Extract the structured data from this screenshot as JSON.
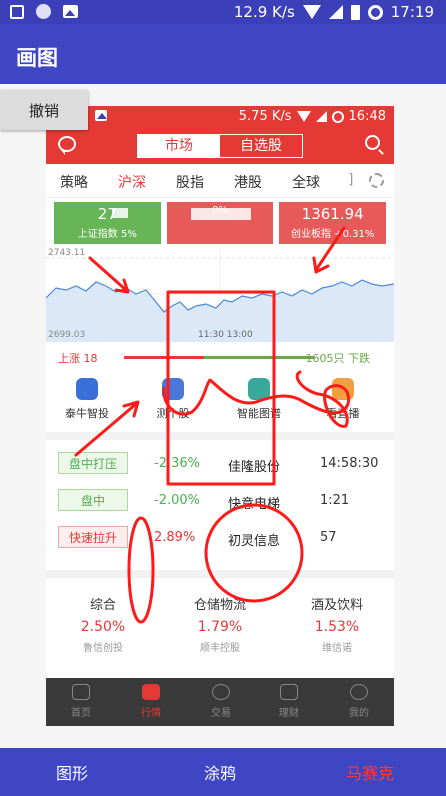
{
  "status_bar": {
    "speed": "12.9 K/s",
    "time": "17:19"
  },
  "app_bar": {
    "title": "画图"
  },
  "undo_button": {
    "label": "撤销"
  },
  "inner": {
    "status": {
      "speed": "5.75 K/s",
      "time": "16:48"
    },
    "segments": [
      "市场",
      "自选股"
    ],
    "tabs": [
      "策略",
      "沪深",
      "股指",
      "港股",
      "全球",
      "]"
    ],
    "indices": [
      {
        "value": "27",
        "name": "上证指数",
        "change": "5%"
      },
      {
        "value": "",
        "name": "",
        "change": "0%"
      },
      {
        "value": "1361.94",
        "name": "创业板指",
        "change": "+0.31%"
      }
    ],
    "chart": {
      "top_label": "2743.11",
      "bottom_label": "2699.03",
      "time_label": "11:30 13:00"
    },
    "updown": {
      "up": "上涨 18",
      "down": "1605只 下跌"
    },
    "features": [
      "泰牛智投",
      "测个股",
      "智能图谱",
      "看直播"
    ],
    "rows": [
      {
        "tag": "盘中打压",
        "pct": "-2.36%",
        "name": "佳隆股份",
        "time": "14:58:30"
      },
      {
        "tag": "盘中",
        "pct": "-2.00%",
        "name": "快意电梯",
        "time": "1:21"
      },
      {
        "tag": "快速拉升",
        "pct": "2.89%",
        "name": "初灵信息",
        "time": "57"
      }
    ],
    "sectors": [
      {
        "name": "综合",
        "pct": "2.50%",
        "stock": "鲁信创投"
      },
      {
        "name": "仓储物流",
        "pct": "1.79%",
        "stock": "顺丰控股"
      },
      {
        "name": "酒及饮料",
        "pct": "1.53%",
        "stock": "维信诺"
      }
    ],
    "nav": [
      "首页",
      "行情",
      "交易",
      "理财",
      "我的"
    ]
  },
  "toolbar": {
    "shape": "图形",
    "doodle": "涂鸦",
    "mosaic": "马赛克"
  },
  "colors": {
    "accent": "#3f46c4",
    "inner_red": "#e53935",
    "drawing": "#ff1a1a",
    "selected_tool": "#ff3b30"
  }
}
